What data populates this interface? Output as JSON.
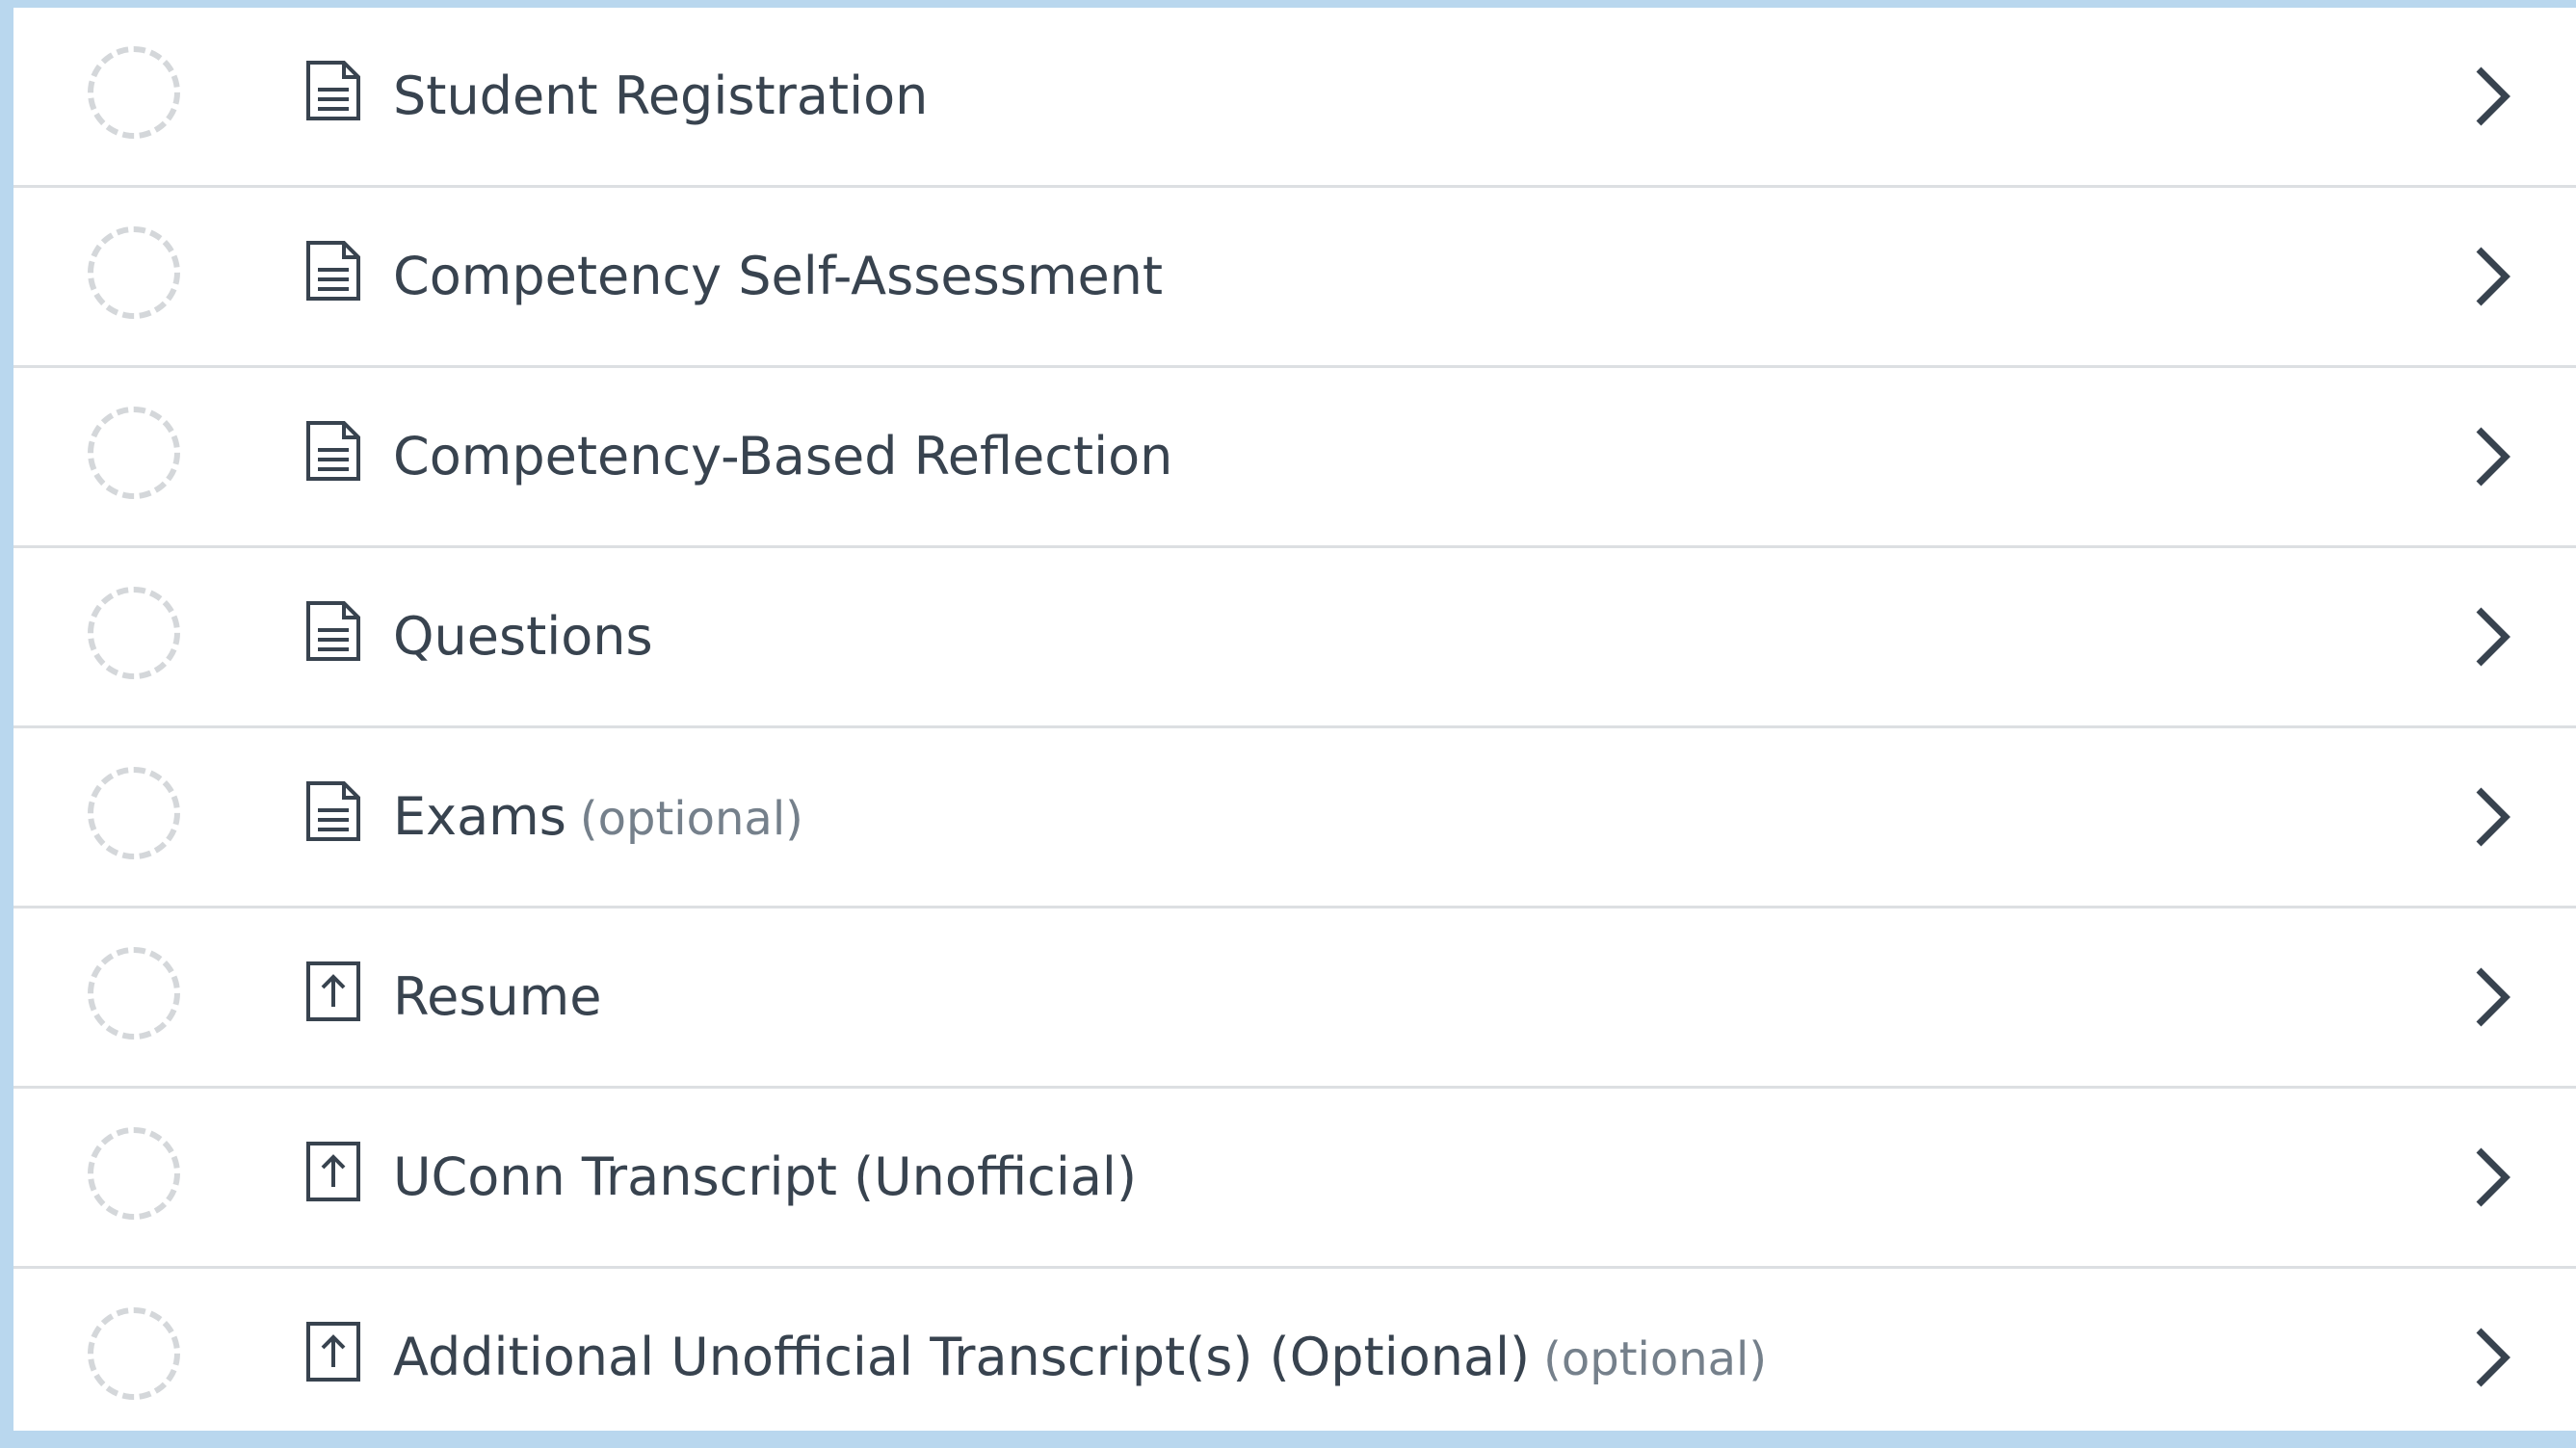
{
  "items": [
    {
      "label": "Student Registration",
      "icon": "document-icon",
      "optional_tag": ""
    },
    {
      "label": "Competency Self-Assessment",
      "icon": "document-icon",
      "optional_tag": ""
    },
    {
      "label": "Competency-Based Reflection",
      "icon": "document-icon",
      "optional_tag": ""
    },
    {
      "label": "Questions",
      "icon": "document-icon",
      "optional_tag": ""
    },
    {
      "label": "Exams",
      "icon": "document-icon",
      "optional_tag": "(optional)"
    },
    {
      "label": "Resume",
      "icon": "upload-icon",
      "optional_tag": ""
    },
    {
      "label": "UConn Transcript (Unofficial)",
      "icon": "upload-icon",
      "optional_tag": ""
    },
    {
      "label": "Additional Unofficial Transcript(s) (Optional)",
      "icon": "upload-icon",
      "optional_tag": "(optional)"
    }
  ],
  "colors": {
    "text": "#38434f",
    "muted_text": "#75808b",
    "divider": "#dcdfe2",
    "status_ring": "#d4d7da",
    "frame_accent": "#b9d7ee"
  }
}
